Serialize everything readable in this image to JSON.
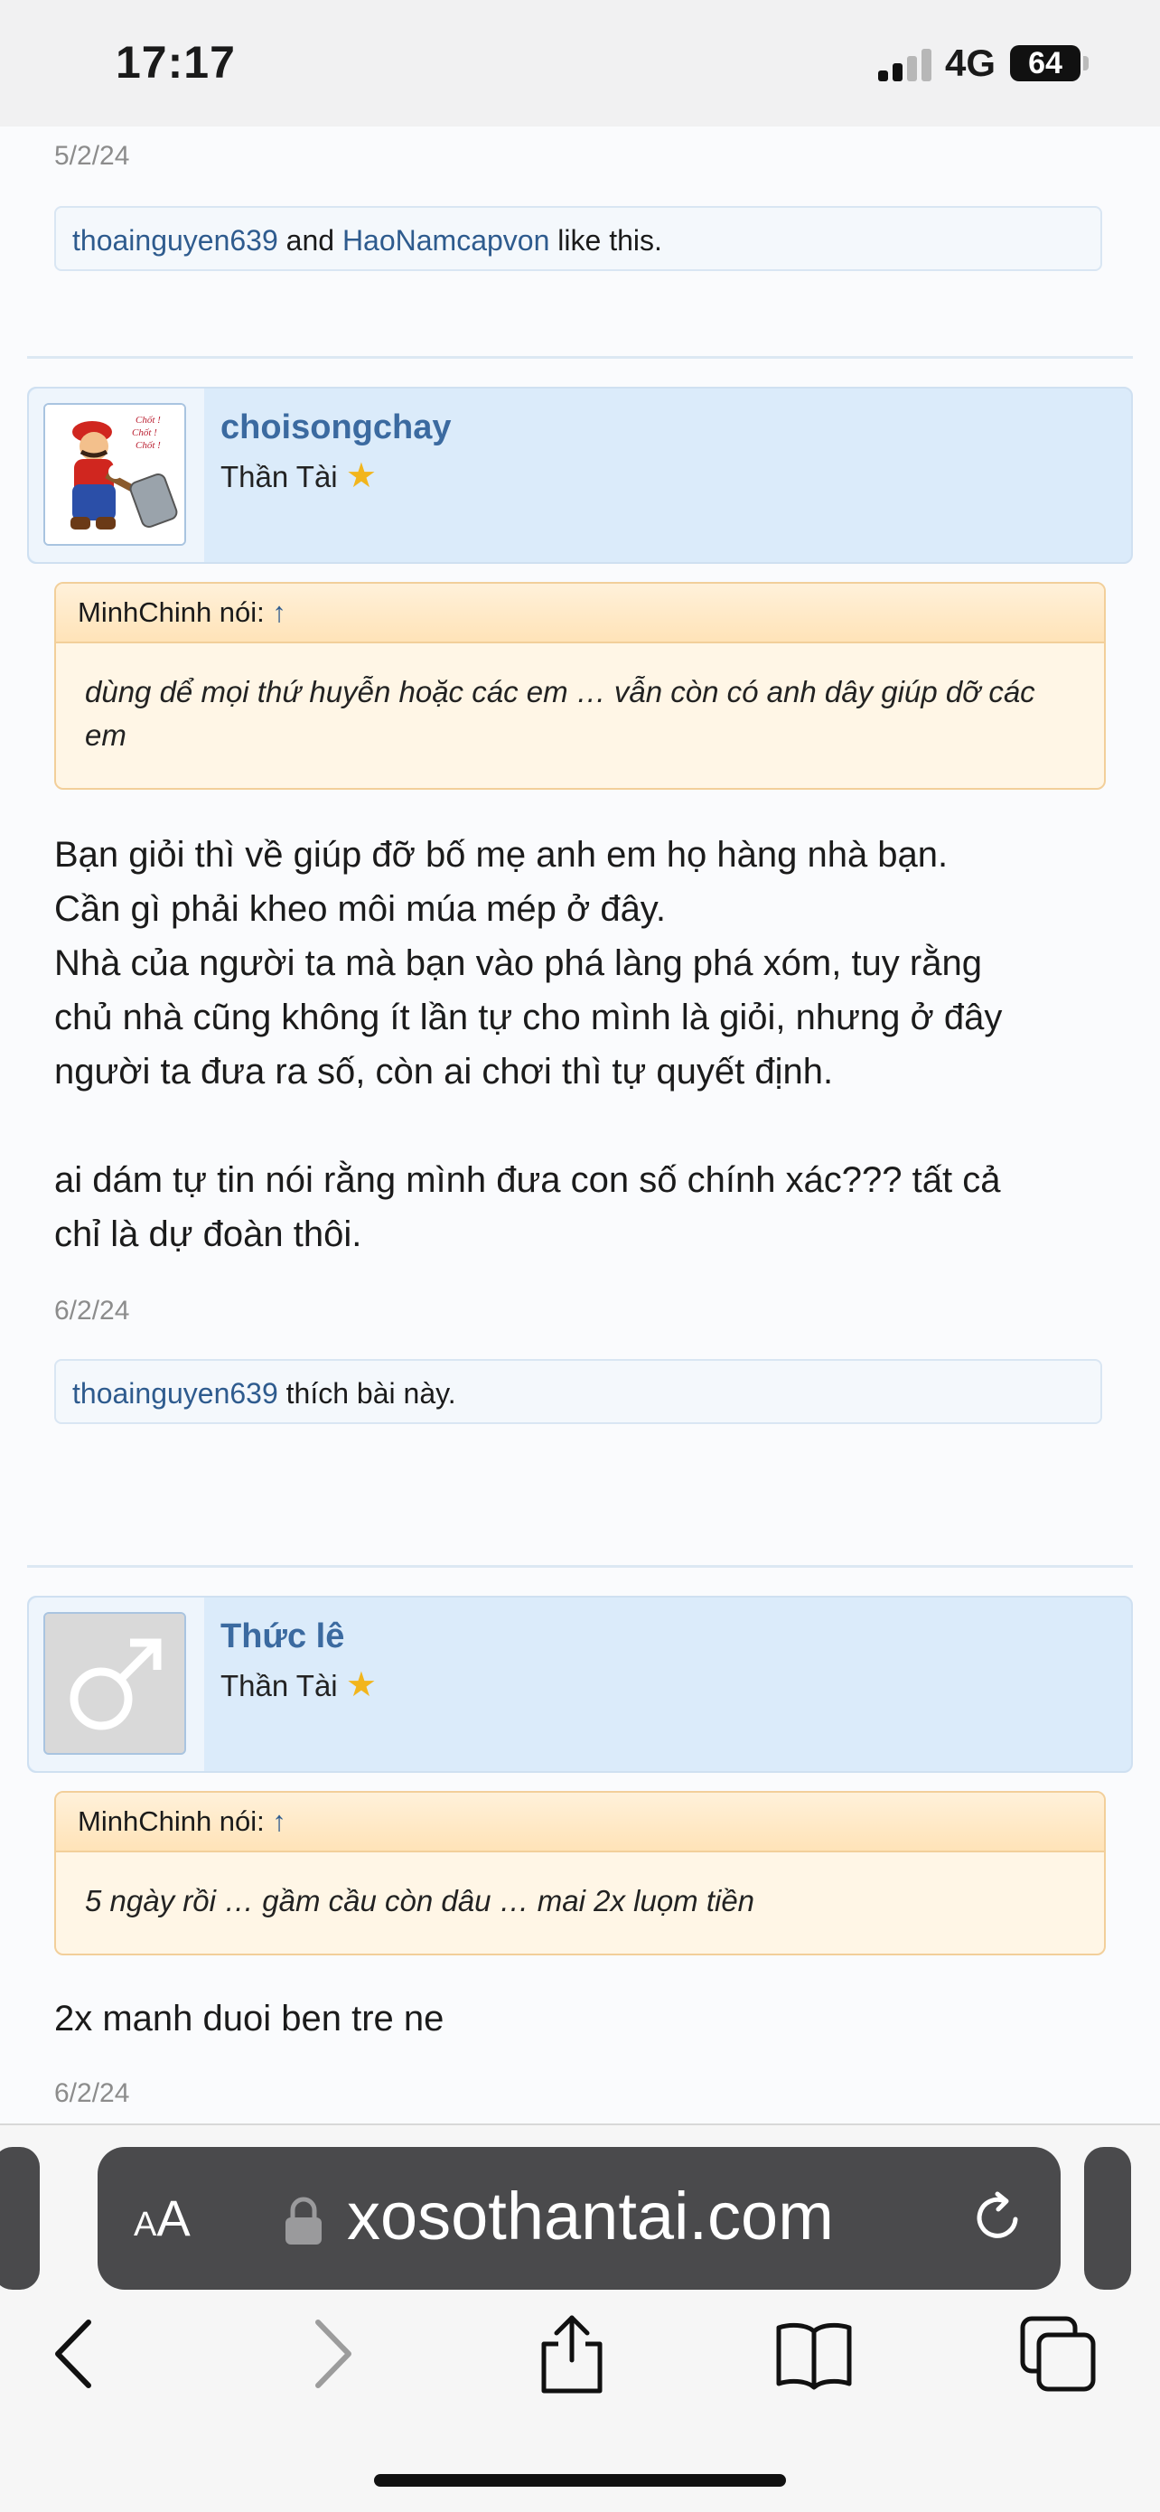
{
  "status": {
    "time": "17:17",
    "network": "4G",
    "battery": "64"
  },
  "posts": {
    "p0": {
      "date": "5/2/24",
      "likes": {
        "user1": "thoainguyen639",
        "joiner": "and",
        "user2": "HaoNamcapvon",
        "suffix": "like this."
      }
    },
    "p1": {
      "username": "choisongchay",
      "user_title": "Thần Tài",
      "quote_author": "MinhChinh nói:",
      "quote_arrow": "↑",
      "quote_text": "dùng dể mọi thứ huyễn hoặc các em … vẫn còn có anh dây giúp dỡ các em",
      "message_lines": [
        "Bạn giỏi thì về giúp đỡ bố mẹ anh em họ hàng nhà bạn.",
        "Cần gì phải kheo môi múa mép ở đây.",
        "Nhà của người ta mà bạn vào phá làng phá xóm, tuy rằng",
        "chủ nhà cũng không ít lần tự cho mình là giỏi, nhưng ở đây",
        "người ta đưa ra số, còn ai chơi thì tự quyết định.",
        "",
        "ai dám tự tin nói rằng mình đưa con số chính xác??? tất cả",
        "chỉ là dự đoàn thôi."
      ],
      "date": "6/2/24",
      "likes": {
        "user1": "thoainguyen639",
        "suffix": "thích bài này."
      }
    },
    "p2": {
      "username": "Thức lê",
      "user_title": "Thần Tài",
      "quote_author": "MinhChinh nói:",
      "quote_arrow": "↑",
      "quote_text": "5 ngày rồi … gầm cầu còn dâu … mai 2x luọm tiền",
      "message": "2x manh duoi ben tre ne",
      "date": "6/2/24"
    }
  },
  "browser": {
    "aa_small": "A",
    "aa_large": "A",
    "url": "xosothantai.com"
  },
  "icons": {
    "star": "star-icon",
    "lock": "lock-icon",
    "reload": "reload-icon",
    "back": "chevron-left-icon",
    "forward": "chevron-right-icon",
    "share": "share-icon",
    "bookmarks": "book-icon",
    "tabs": "tabs-icon"
  }
}
